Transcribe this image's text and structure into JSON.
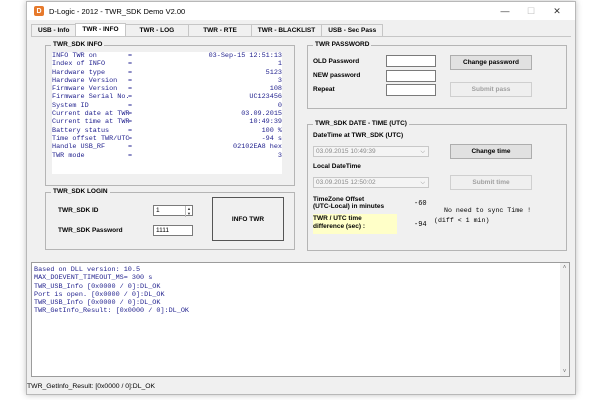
{
  "window": {
    "title": "D-Logic - 2012 - TWR_SDK Demo V2.00",
    "app_icon_glyph": "D",
    "minimize_glyph": "—",
    "maximize_glyph": "☐",
    "close_glyph": "✕"
  },
  "tabs": [
    {
      "label": "USB - Info"
    },
    {
      "label": "TWR - INFO"
    },
    {
      "label": "TWR - LOG"
    },
    {
      "label": "TWR - RTE"
    },
    {
      "label": "TWR - BLACKLIST"
    },
    {
      "label": "USB - Sec Pass"
    }
  ],
  "active_tab": "TWR - INFO",
  "sdk_info": {
    "legend": "TWR_SDK INFO",
    "rows": [
      {
        "label": "INFO TWR on",
        "eq": "=",
        "value": "03-Sep-15 12:51:13"
      },
      {
        "label": "Index of INFO",
        "eq": "=",
        "value": "1"
      },
      {
        "label": "Hardware type",
        "eq": "=",
        "value": "5123"
      },
      {
        "label": "Hardware Version",
        "eq": "=",
        "value": "3"
      },
      {
        "label": "Firmware Version",
        "eq": "=",
        "value": "108"
      },
      {
        "label": "Firmware Serial No.",
        "eq": "=",
        "value": "UC123456"
      },
      {
        "label": "System ID",
        "eq": "=",
        "value": "0"
      },
      {
        "label": "Current date at TWR",
        "eq": "=",
        "value": "03.09.2015"
      },
      {
        "label": "Current time at TWR",
        "eq": "=",
        "value": "10:49:39"
      },
      {
        "label": "Battery status",
        "eq": "=",
        "value": "100 %"
      },
      {
        "label": "Time offset TWR/UTC",
        "eq": "=",
        "value": "-94 s"
      },
      {
        "label": "Handle USB_RF",
        "eq": "=",
        "value": "02102EA8 hex"
      },
      {
        "label": "TWR mode",
        "eq": "=",
        "value": "3"
      }
    ]
  },
  "login": {
    "legend": "TWR_SDK LOGIN",
    "id_label": "TWR_SDK ID",
    "id_value": "1",
    "password_label": "TWR_SDK Password",
    "password_value": "1111",
    "info_button": "INFO TWR"
  },
  "password": {
    "legend": "TWR PASSWORD",
    "old_label": "OLD Password",
    "new_label": "NEW password",
    "repeat_label": "Repeat",
    "old_value": "",
    "new_value": "",
    "repeat_value": "",
    "change_button": "Change password",
    "submit_button": "Submit pass"
  },
  "datetime": {
    "legend": "TWR_SDK DATE - TIME (UTC)",
    "twr_label": "DateTime at TWR_SDK (UTC)",
    "twr_value": "03.09.2015 10:49:39",
    "change_button": "Change time",
    "local_label": "Local DateTime",
    "local_value": "03.09.2015 12:50:02",
    "submit_button": "Submit time",
    "tz_label_1": "TimeZone Offset",
    "tz_label_2": "(UTC-Local) in minutes",
    "tz_value": "-60",
    "diff_label_1": "TWR / UTC time",
    "diff_label_2": "difference (sec) :",
    "diff_value": "-94",
    "sync_msg_1": "No need to sync Time !",
    "sync_msg_2": "(diff < 1 min)",
    "highlight_color": "#ffffc8"
  },
  "log": {
    "lines": [
      "Based on DLL version: 10.5",
      "MAX_DOEVENT_TIMEOUT_MS= 300 s",
      "TWR_USB_Info [0x0000 / 0]:DL_OK",
      "Port is open. [0x0000 / 0]:DL_OK",
      "TWR_USB_Info [0x0000 / 0]:DL_OK",
      "TWR_GetInfo_Result: [0x0000 / 0]:DL_OK"
    ],
    "scroll_up_glyph": "˄",
    "scroll_down_glyph": "˅"
  },
  "status": {
    "text": "TWR_GetInfo_Result: [0x0000 / 0]:DL_OK"
  },
  "colors": {
    "info_text": "#1e1e8c",
    "app_icon": "#e6792b"
  }
}
